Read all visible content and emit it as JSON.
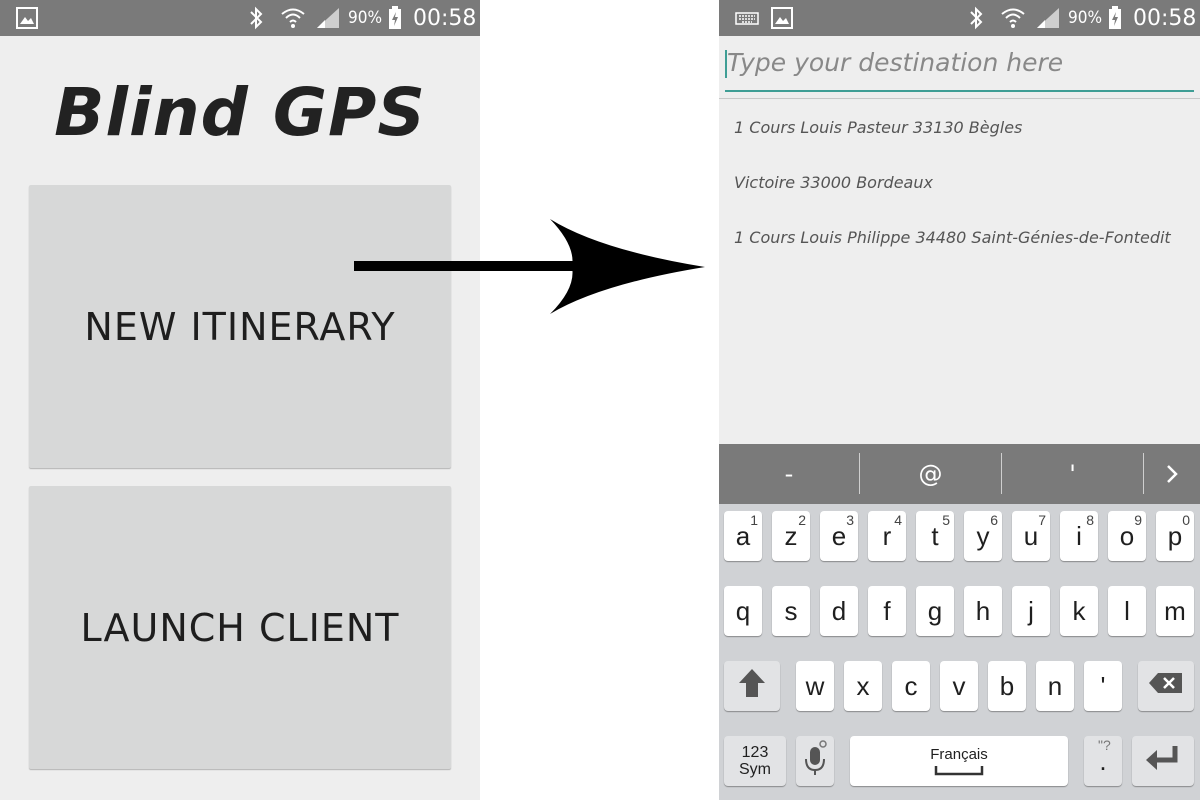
{
  "status_bar": {
    "battery": "90%",
    "time": "00:58"
  },
  "left_screen": {
    "app_title": "Blind GPS",
    "new_itinerary_label": "NEW ITINERARY",
    "launch_client_label": "LAUNCH CLIENT"
  },
  "right_screen": {
    "destination_placeholder": "Type your destination here",
    "suggestions": [
      "1 Cours Louis Pasteur 33130 Bègles",
      "Victoire 33000 Bordeaux",
      "1 Cours Louis Philippe 34480 Saint-Génies-de-Fontedit"
    ]
  },
  "keyboard": {
    "suggestion_keys": [
      "-",
      "@",
      "'"
    ],
    "row1": [
      {
        "char": "a",
        "num": "1"
      },
      {
        "char": "z",
        "num": "2"
      },
      {
        "char": "e",
        "num": "3"
      },
      {
        "char": "r",
        "num": "4"
      },
      {
        "char": "t",
        "num": "5"
      },
      {
        "char": "y",
        "num": "6"
      },
      {
        "char": "u",
        "num": "7"
      },
      {
        "char": "i",
        "num": "8"
      },
      {
        "char": "o",
        "num": "9"
      },
      {
        "char": "p",
        "num": "0"
      }
    ],
    "row2": [
      "q",
      "s",
      "d",
      "f",
      "g",
      "h",
      "j",
      "k",
      "l",
      "m"
    ],
    "row3": [
      "w",
      "x",
      "c",
      "v",
      "b",
      "n",
      "'"
    ],
    "sym_key_top": "123",
    "sym_key_bottom": "Sym",
    "space_label": "Français",
    "period_key": ".",
    "period_key_hint": "\"?"
  },
  "colors": {
    "accent": "#3f9e95",
    "status_bar": "#7a7a7a",
    "screen_bg": "#eeeeee",
    "button_bg": "#d7d8d8"
  },
  "icons": [
    "image-icon",
    "bluetooth-icon",
    "wifi-icon",
    "signal-icon",
    "battery-charging-icon",
    "keyboard-icon",
    "arrow-right-icon",
    "shift-icon",
    "backspace-icon",
    "microphone-icon",
    "enter-icon",
    "chevron-right-icon"
  ]
}
